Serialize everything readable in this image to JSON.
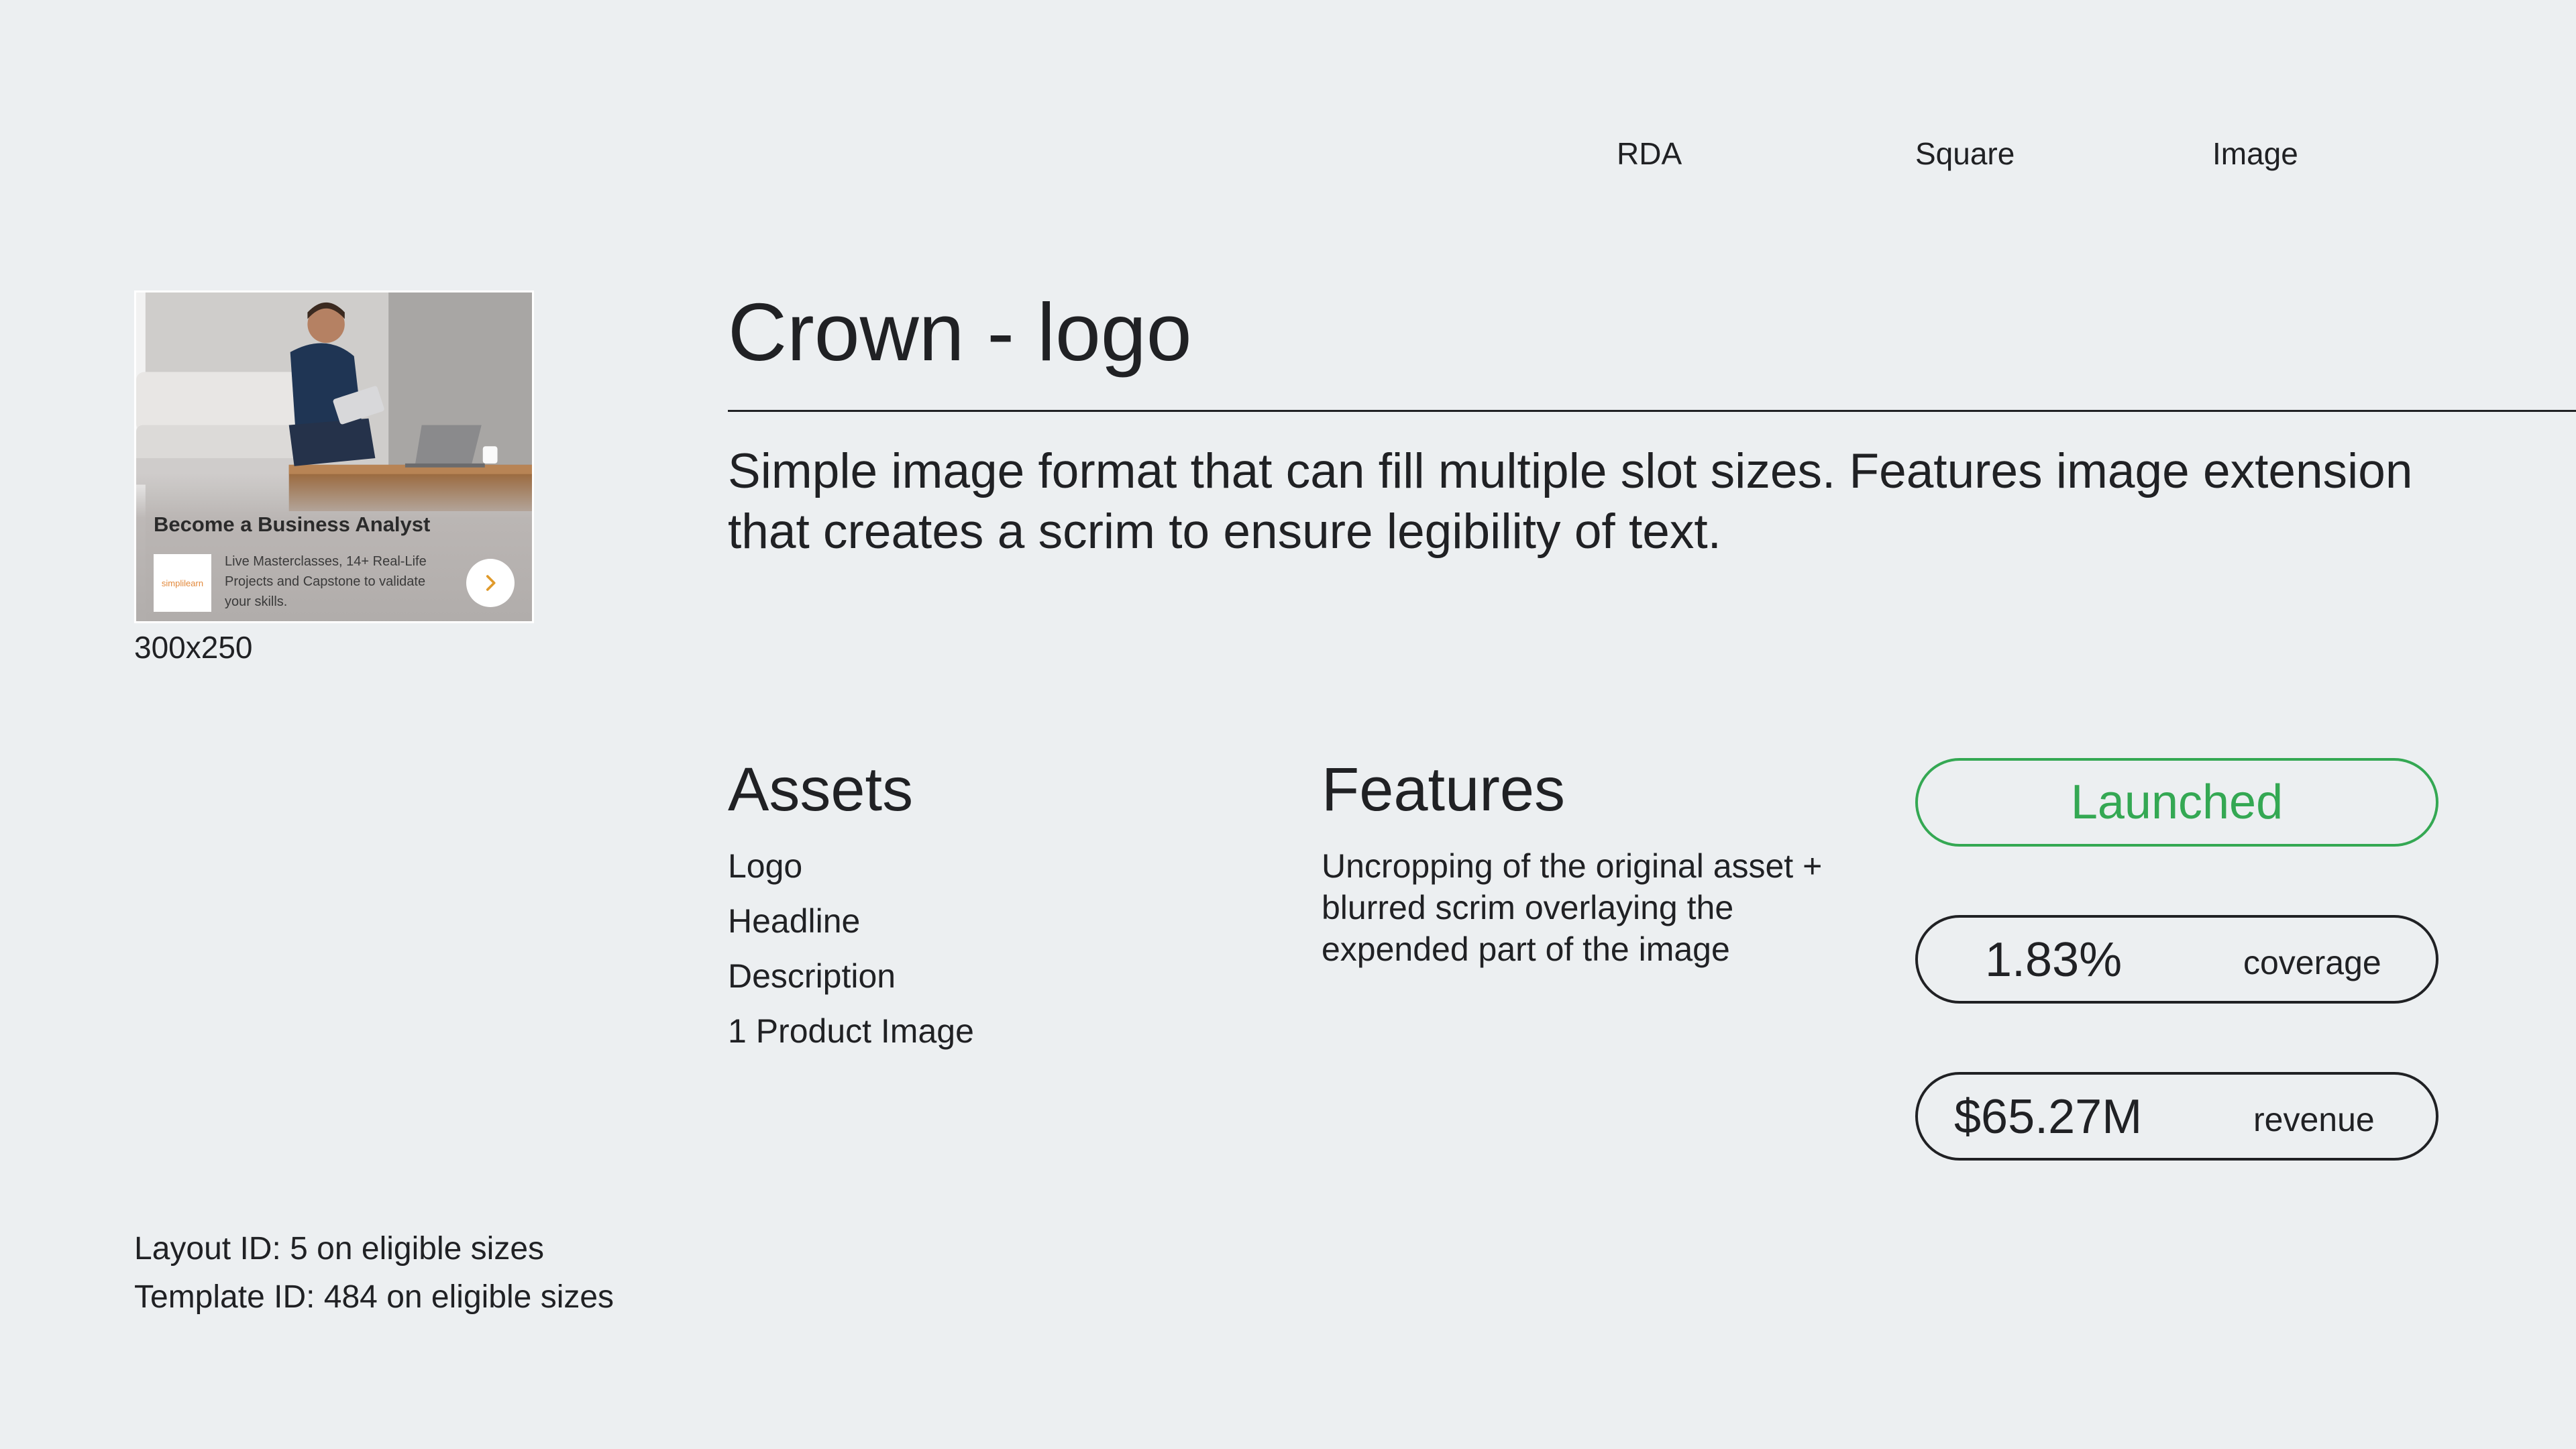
{
  "tags": [
    "RDA",
    "Square",
    "Image"
  ],
  "preview": {
    "headline": "Become a Business Analyst",
    "logo_text": "simplilearn",
    "description": "Live Masterclasses, 14+ Real-Life Projects and Capstone to validate your skills.",
    "size": "300x250"
  },
  "title": "Crown - logo",
  "description": "Simple image format that can fill multiple slot sizes. Features image extension that creates a scrim to ensure legibility of text.",
  "assets": {
    "heading": "Assets",
    "items": [
      "Logo",
      "Headline",
      "Description",
      "1 Product Image"
    ]
  },
  "features": {
    "heading": "Features",
    "text": "Uncropping of the original asset + blurred scrim overlaying the expended part of the image"
  },
  "status": {
    "label": "Launched",
    "color": "#34a853"
  },
  "metrics": [
    {
      "value": "1.83%",
      "label": "coverage"
    },
    {
      "value": "$65.27M",
      "label": "revenue"
    }
  ],
  "footer": {
    "layout_id": "Layout ID: 5 on eligible sizes",
    "template_id": "Template ID: 484 on eligible sizes"
  }
}
